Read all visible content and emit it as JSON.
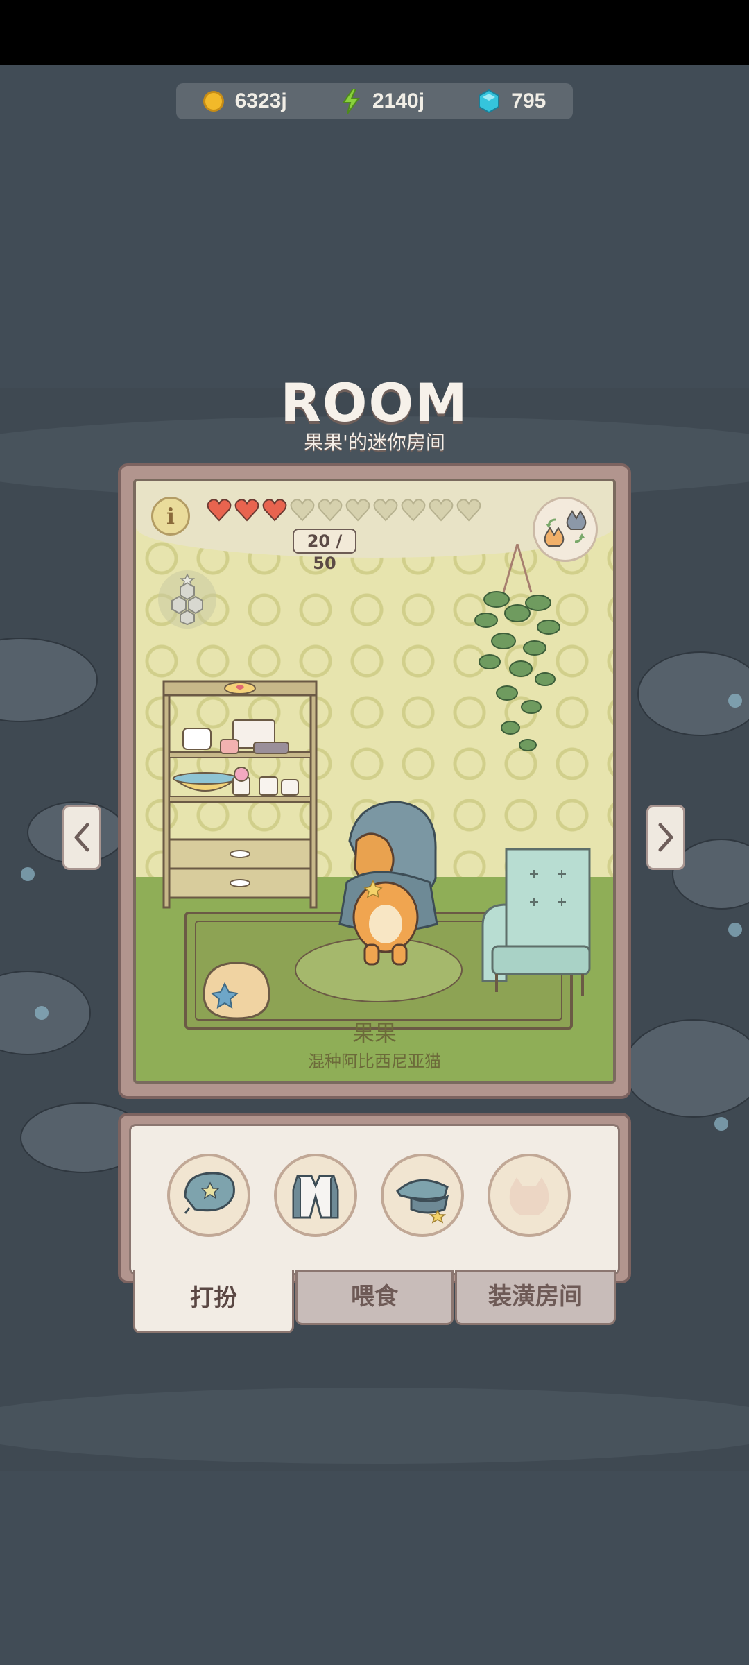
{
  "currency": {
    "coins": "6323j",
    "energy": "2140j",
    "gems": "795"
  },
  "room": {
    "title": "ROOM",
    "subtitle": "果果'的迷你房间"
  },
  "cat": {
    "name": "果果",
    "breed": "混种阿比西尼亚猫",
    "affection_label": "20 / 50",
    "affection_value": 20,
    "affection_max": 50,
    "hearts_filled": 3,
    "hearts_total": 10
  },
  "tabs": {
    "dress_up": "打扮",
    "feed": "喂食",
    "decorate": "装潢房间"
  },
  "colors": {
    "heart_filled": "#e8644f",
    "heart_empty": "#d6d1ae",
    "background": "#414c56"
  }
}
